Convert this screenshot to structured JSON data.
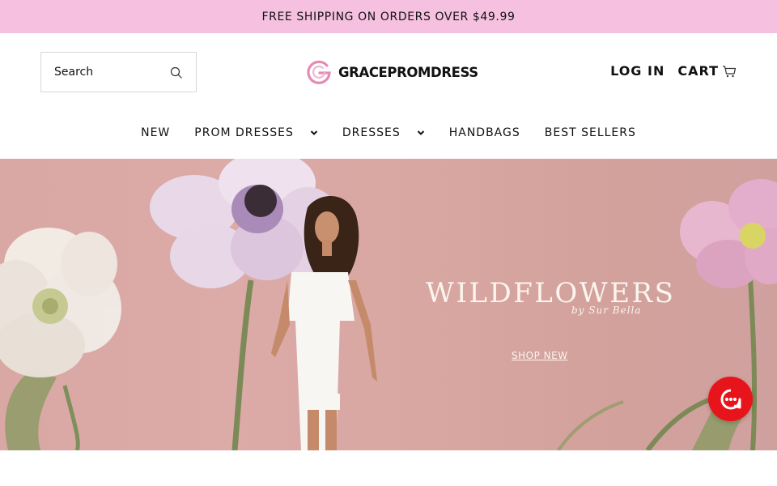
{
  "announcement": "FREE SHIPPING ON ORDERS OVER $49.99",
  "search": {
    "placeholder": "Search",
    "icon": "search-icon"
  },
  "logo": {
    "text": "GRACEPROMDRESS",
    "color": "#e58ab5"
  },
  "account": {
    "login_label": "LOG IN",
    "cart_label": "CART",
    "cart_icon": "cart-icon"
  },
  "nav": {
    "items": [
      {
        "label": "NEW",
        "has_dropdown": false
      },
      {
        "label": "PROM DRESSES",
        "has_dropdown": true
      },
      {
        "label": "DRESSES",
        "has_dropdown": true
      },
      {
        "label": "HANDBAGS",
        "has_dropdown": false
      },
      {
        "label": "BEST SELLERS",
        "has_dropdown": false
      }
    ]
  },
  "hero": {
    "title": "WILDFLOWERS",
    "signature": "by Sur Bella",
    "cta": "SHOP NEW",
    "background_color": "#d9a8a4"
  },
  "chat": {
    "icon": "chat-icon",
    "color": "#e8141b"
  },
  "colors": {
    "announcement_bg": "#f6c1e0",
    "text": "#111111"
  }
}
